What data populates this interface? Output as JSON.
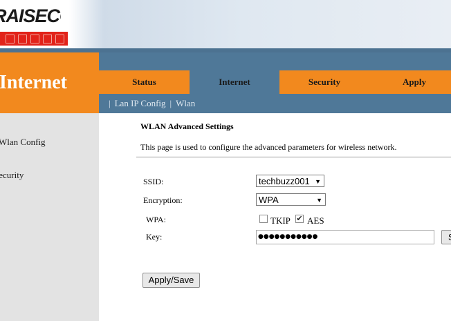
{
  "brand": {
    "name": "RAISECOM"
  },
  "header": {
    "section_title": "Internet"
  },
  "tabs": [
    {
      "label": "Status"
    },
    {
      "label": "Internet"
    },
    {
      "label": "Security"
    },
    {
      "label": "Apply"
    }
  ],
  "subnav": {
    "separator": "|",
    "items": [
      "Lan IP Config",
      "Wlan"
    ]
  },
  "sidebar": {
    "items": [
      "Wlan Config",
      "Security"
    ]
  },
  "main": {
    "title": "WLAN Advanced Settings",
    "description": "This page is used to configure the advanced parameters for wireless network.",
    "form": {
      "ssid_label": "SSID:",
      "ssid_value": "techbuzz001",
      "encryption_label": "Encryption:",
      "encryption_value": "WPA",
      "wpa_label": "WPA:",
      "tkip_label": "TKIP",
      "tkip_checked": false,
      "aes_label": "AES",
      "aes_checked": true,
      "key_label": "Key:",
      "key_value": "●●●●●●●●●●●",
      "key_side_button": "S"
    },
    "apply_button": "Apply/Save"
  },
  "colors": {
    "orange": "#f2891e",
    "steel_blue": "#4f7898",
    "sidebar_gray": "#e3e3e3"
  }
}
